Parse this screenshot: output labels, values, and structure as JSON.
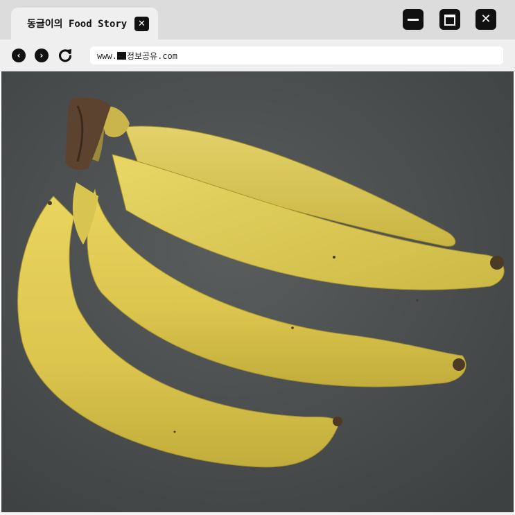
{
  "tab": {
    "title": "동글이의 Food Story",
    "close_icon": "close-icon"
  },
  "window_controls": {
    "minimize_icon": "minimize-icon",
    "maximize_icon": "maximize-icon",
    "close_icon": "close-icon"
  },
  "toolbar": {
    "back_icon": "chevron-left-icon",
    "forward_icon": "chevron-right-icon",
    "reload_icon": "reload-icon",
    "url_prefix": "www.",
    "url_suffix": "정보공유.com"
  },
  "content": {
    "image": "bananas-photo"
  },
  "colors": {
    "titlebar": "#dcdcdc",
    "tab": "#efefef",
    "toolbar": "#efefef",
    "background": "#4c4f50",
    "banana": "#e2cc55"
  }
}
